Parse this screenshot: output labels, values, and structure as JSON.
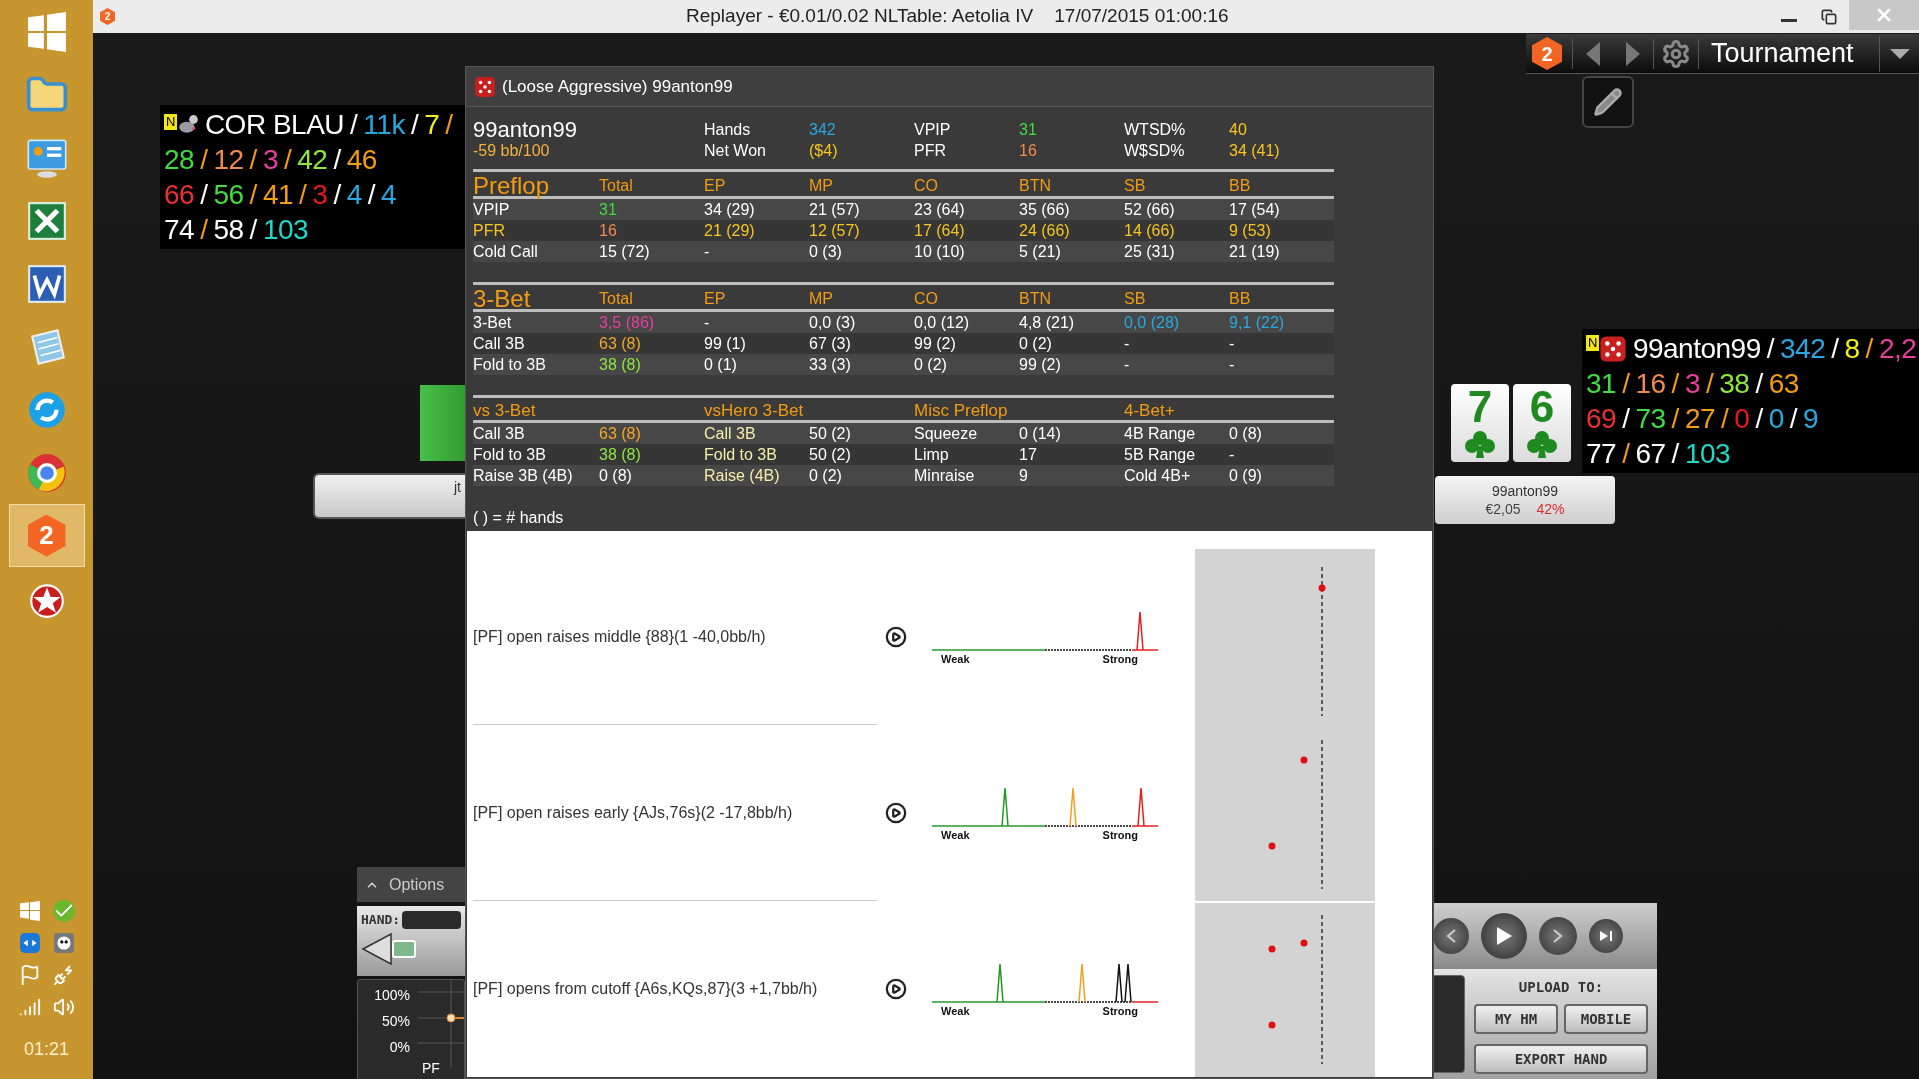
{
  "window": {
    "app_badge": "2",
    "title": "Replayer - €0.01/0.02 NLTable: Aetolia IV    17/07/2015 01:00:16"
  },
  "taskbar": {
    "apps": [
      {
        "kind": "start",
        "selected": false
      },
      {
        "kind": "folder",
        "selected": false
      },
      {
        "kind": "control",
        "selected": false
      },
      {
        "kind": "spreadsheet",
        "selected": false
      },
      {
        "kind": "document",
        "selected": false
      },
      {
        "kind": "notepad",
        "selected": false
      },
      {
        "kind": "chat",
        "selected": false
      },
      {
        "kind": "browser",
        "selected": false
      },
      {
        "kind": "hm",
        "label": "2",
        "selected": true
      },
      {
        "kind": "poker",
        "selected": false
      }
    ],
    "clock": "01:21"
  },
  "toolbar": {
    "badge": "2",
    "profile": "Tournament"
  },
  "hud_left": {
    "note": "N",
    "name": {
      "text": "COR BLAU",
      "color": "#ffffff"
    },
    "header": [
      {
        "text": "/",
        "color": "#ffffff"
      },
      {
        "text": "11k",
        "color": "#29a8e0"
      },
      {
        "text": "/",
        "color": "#ffffff"
      },
      {
        "text": "7",
        "color": "#f0f020"
      },
      {
        "text": "/",
        "color": "#f39c12"
      }
    ],
    "lines": [
      {
        "segments": [
          {
            "text": "28",
            "color": "#3fdc3f"
          },
          {
            "text": "/",
            "color": "#f39c12"
          },
          {
            "text": "12",
            "color": "#f08a4b"
          },
          {
            "text": "/",
            "color": "#f39c12"
          },
          {
            "text": "3",
            "color": "#e83e9c"
          },
          {
            "text": "/",
            "color": "#f39c12"
          },
          {
            "text": "42",
            "color": "#8fe63f"
          },
          {
            "text": "/",
            "color": "#ffffff"
          },
          {
            "text": "46",
            "color": "#f39c12"
          }
        ]
      },
      {
        "segments": [
          {
            "text": "66",
            "color": "#e83030"
          },
          {
            "text": "/",
            "color": "#ffffff"
          },
          {
            "text": "56",
            "color": "#3fdc3f"
          },
          {
            "text": "/",
            "color": "#f39c12"
          },
          {
            "text": "41",
            "color": "#f39c12"
          },
          {
            "text": "/",
            "color": "#f39c12"
          },
          {
            "text": "3",
            "color": "#e81a1a"
          },
          {
            "text": "/",
            "color": "#ffffff"
          },
          {
            "text": "4",
            "color": "#29a8e0"
          },
          {
            "text": "/",
            "color": "#ffffff"
          },
          {
            "text": "4",
            "color": "#29a8e0"
          }
        ]
      },
      {
        "segments": [
          {
            "text": "74",
            "color": "#ffffff"
          },
          {
            "text": "/",
            "color": "#f39c12"
          },
          {
            "text": "58",
            "color": "#ffffff"
          },
          {
            "text": "/",
            "color": "#ffffff"
          },
          {
            "text": "103",
            "color": "#20d8c8"
          }
        ]
      }
    ]
  },
  "left_seat": {
    "name": "jt"
  },
  "hud_right": {
    "note": "N",
    "name": {
      "text": "99anton99",
      "color": "#ffffff"
    },
    "header": [
      {
        "text": "/",
        "color": "#ffffff"
      },
      {
        "text": "342",
        "color": "#29a8e0"
      },
      {
        "text": "/",
        "color": "#ffffff"
      },
      {
        "text": "8",
        "color": "#f0f020"
      },
      {
        "text": "/",
        "color": "#f39c12"
      },
      {
        "text": "2,2",
        "color": "#e83e9c"
      }
    ],
    "lines": [
      {
        "segments": [
          {
            "text": "31",
            "color": "#3fdc3f"
          },
          {
            "text": "/",
            "color": "#f39c12"
          },
          {
            "text": "16",
            "color": "#f08a4b"
          },
          {
            "text": "/",
            "color": "#f39c12"
          },
          {
            "text": "3",
            "color": "#e83e9c"
          },
          {
            "text": "/",
            "color": "#f39c12"
          },
          {
            "text": "38",
            "color": "#8fe63f"
          },
          {
            "text": "/",
            "color": "#ffffff"
          },
          {
            "text": "63",
            "color": "#f39c12"
          }
        ]
      },
      {
        "segments": [
          {
            "text": "69",
            "color": "#e83030"
          },
          {
            "text": "/",
            "color": "#ffffff"
          },
          {
            "text": "73",
            "color": "#3fdc3f"
          },
          {
            "text": "/",
            "color": "#f39c12"
          },
          {
            "text": "27",
            "color": "#f39c12"
          },
          {
            "text": "/",
            "color": "#f39c12"
          },
          {
            "text": "0",
            "color": "#e81a1a"
          },
          {
            "text": "/",
            "color": "#ffffff"
          },
          {
            "text": "0",
            "color": "#29a8e0"
          },
          {
            "text": "/",
            "color": "#ffffff"
          },
          {
            "text": "9",
            "color": "#29a8e0"
          }
        ]
      },
      {
        "segments": [
          {
            "text": "77",
            "color": "#ffffff"
          },
          {
            "text": "/",
            "color": "#f39c12"
          },
          {
            "text": "67",
            "color": "#ffffff"
          },
          {
            "text": "/",
            "color": "#ffffff"
          },
          {
            "text": "103",
            "color": "#20d8c8"
          }
        ]
      }
    ]
  },
  "seat": {
    "cards": [
      {
        "rank": "7"
      },
      {
        "rank": "6"
      }
    ],
    "name": "99anton99",
    "stack": "€2,05",
    "equity": "42%"
  },
  "popup": {
    "title": "(Loose Aggressive) 99anton99",
    "summary": {
      "name": "99anton99",
      "winrate": "-59 bb/100",
      "rows": [
        [
          {
            "text": "Hands",
            "color": "#ffffff"
          },
          {
            "text": "342",
            "color": "#29a8e0"
          },
          {
            "text": "VPIP",
            "color": "#ffffff"
          },
          {
            "text": "31",
            "color": "#3fdc3f"
          },
          {
            "text": "WTSD%",
            "color": "#ffffff"
          },
          {
            "text": "40",
            "color": "#f7c51e"
          }
        ],
        [
          {
            "text": "Net Won",
            "color": "#ffffff"
          },
          {
            "text": "($4)",
            "color": "#f7c51e"
          },
          {
            "text": "PFR",
            "color": "#ffffff"
          },
          {
            "text": "16",
            "color": "#f08a4b"
          },
          {
            "text": "W$SD%",
            "color": "#ffffff"
          },
          {
            "text": "34 (41)",
            "color": "#f7c51e"
          }
        ]
      ]
    },
    "sections": [
      {
        "kind": "major",
        "columns": [
          {
            "text": "Preflop"
          },
          {
            "text": "Total"
          },
          {
            "text": "EP"
          },
          {
            "text": "MP"
          },
          {
            "text": "CO"
          },
          {
            "text": "BTN"
          },
          {
            "text": "SB"
          },
          {
            "text": "BB"
          }
        ],
        "rows": [
          [
            {
              "text": "VPIP",
              "color": "#ffffff"
            },
            {
              "text": "31",
              "color": "#3fdc3f"
            },
            {
              "text": "34 (29)",
              "color": "#ffffff"
            },
            {
              "text": "21 (57)",
              "color": "#ffffff"
            },
            {
              "text": "23 (64)",
              "color": "#ffffff"
            },
            {
              "text": "35 (66)",
              "color": "#ffffff"
            },
            {
              "text": "52 (66)",
              "color": "#ffffff"
            },
            {
              "text": "17 (54)",
              "color": "#ffffff"
            }
          ],
          [
            {
              "text": "PFR",
              "color": "#f7c51e"
            },
            {
              "text": "16",
              "color": "#f08a4b"
            },
            {
              "text": "21 (29)",
              "color": "#f7c51e"
            },
            {
              "text": "12 (57)",
              "color": "#f7c51e"
            },
            {
              "text": "17 (64)",
              "color": "#f7c51e"
            },
            {
              "text": "24 (66)",
              "color": "#f7c51e"
            },
            {
              "text": "14 (66)",
              "color": "#f7c51e"
            },
            {
              "text": "9 (53)",
              "color": "#f7c51e"
            }
          ],
          [
            {
              "text": "Cold Call",
              "color": "#ffffff"
            },
            {
              "text": "15 (72)",
              "color": "#ffffff"
            },
            {
              "text": "-",
              "color": "#ffffff"
            },
            {
              "text": "0 (3)",
              "color": "#ffffff"
            },
            {
              "text": "10 (10)",
              "color": "#ffffff"
            },
            {
              "text": "5 (21)",
              "color": "#ffffff"
            },
            {
              "text": "25 (31)",
              "color": "#ffffff"
            },
            {
              "text": "21 (19)",
              "color": "#ffffff"
            }
          ]
        ]
      },
      {
        "kind": "major",
        "columns": [
          {
            "text": "3-Bet"
          },
          {
            "text": "Total"
          },
          {
            "text": "EP"
          },
          {
            "text": "MP"
          },
          {
            "text": "CO"
          },
          {
            "text": "BTN"
          },
          {
            "text": "SB"
          },
          {
            "text": "BB"
          }
        ],
        "rows": [
          [
            {
              "text": "3-Bet",
              "color": "#ffffff"
            },
            {
              "text": "3,5 (86)",
              "color": "#e83e9c"
            },
            {
              "text": "-",
              "color": "#ffffff"
            },
            {
              "text": "0,0 (3)",
              "color": "#ffffff"
            },
            {
              "text": "0,0 (12)",
              "color": "#ffffff"
            },
            {
              "text": "4,8 (21)",
              "color": "#ffffff"
            },
            {
              "text": "0,0 (28)",
              "color": "#29a8e0"
            },
            {
              "text": "9,1 (22)",
              "color": "#29a8e0"
            }
          ],
          [
            {
              "text": "Call 3B",
              "color": "#ffffff"
            },
            {
              "text": "63 (8)",
              "color": "#f5a623"
            },
            {
              "text": "99 (1)",
              "color": "#ffffff"
            },
            {
              "text": "67 (3)",
              "color": "#ffffff"
            },
            {
              "text": "99 (2)",
              "color": "#ffffff"
            },
            {
              "text": "0 (2)",
              "color": "#ffffff"
            },
            {
              "text": "-",
              "color": "#ffffff"
            },
            {
              "text": "-",
              "color": "#ffffff"
            }
          ],
          [
            {
              "text": "Fold to 3B",
              "color": "#ffffff"
            },
            {
              "text": "38 (8)",
              "color": "#8fe63f"
            },
            {
              "text": "0 (1)",
              "color": "#ffffff"
            },
            {
              "text": "33 (3)",
              "color": "#ffffff"
            },
            {
              "text": "0 (2)",
              "color": "#ffffff"
            },
            {
              "text": "99 (2)",
              "color": "#ffffff"
            },
            {
              "text": "-",
              "color": "#ffffff"
            },
            {
              "text": "-",
              "color": "#ffffff"
            }
          ]
        ]
      },
      {
        "kind": "minor",
        "columns": [
          {
            "text": "vs 3-Bet"
          },
          {
            "text": ""
          },
          {
            "text": "vsHero 3-Bet"
          },
          {
            "text": ""
          },
          {
            "text": "Misc Preflop"
          },
          {
            "text": ""
          },
          {
            "text": "4-Bet+"
          },
          {
            "text": ""
          }
        ],
        "rows": [
          [
            {
              "text": "Call 3B",
              "color": "#ffffff"
            },
            {
              "text": "63 (8)",
              "color": "#f5a623"
            },
            {
              "text": "Call 3B",
              "color": "#f3eeaa"
            },
            {
              "text": "50 (2)",
              "color": "#ffffff"
            },
            {
              "text": "Squeeze",
              "color": "#ffffff"
            },
            {
              "text": "0 (14)",
              "color": "#ffffff"
            },
            {
              "text": "4B Range",
              "color": "#ffffff"
            },
            {
              "text": "0 (8)",
              "color": "#ffffff"
            }
          ],
          [
            {
              "text": "Fold to 3B",
              "color": "#ffffff"
            },
            {
              "text": "38 (8)",
              "color": "#8fe63f"
            },
            {
              "text": "Fold to 3B",
              "color": "#f3eeaa"
            },
            {
              "text": "50 (2)",
              "color": "#ffffff"
            },
            {
              "text": "Limp",
              "color": "#ffffff"
            },
            {
              "text": "17",
              "color": "#ffffff"
            },
            {
              "text": "5B Range",
              "color": "#ffffff"
            },
            {
              "text": "-",
              "color": "#ffffff"
            }
          ],
          [
            {
              "text": "Raise 3B (4B)",
              "color": "#ffffff"
            },
            {
              "text": "0 (8)",
              "color": "#ffffff"
            },
            {
              "text": "Raise (4B)",
              "color": "#f3eeaa"
            },
            {
              "text": "0 (2)",
              "color": "#ffffff"
            },
            {
              "text": "Minraise",
              "color": "#ffffff"
            },
            {
              "text": "9",
              "color": "#ffffff"
            },
            {
              "text": "Cold 4B+",
              "color": "#ffffff"
            },
            {
              "text": "0 (9)",
              "color": "#ffffff"
            }
          ]
        ]
      }
    ],
    "footnote": "( ) = # hands",
    "hands": [
      {
        "description": "[PF] open raises middle {88}(1 -40,0bb/h)",
        "weak": "Weak",
        "strong": "Strong"
      },
      {
        "description": "[PF] open raises early {AJs,76s}(2 -17,8bb/h)",
        "weak": "Weak",
        "strong": "Strong"
      },
      {
        "description": "[PF] opens from cutoff {A6s,KQs,87}(3 +1,7bb/h)",
        "weak": "Weak",
        "strong": "Strong"
      }
    ]
  },
  "options": {
    "label": "Options",
    "hand_label": "HAND:",
    "axis": [
      "100%",
      "50%",
      "0%"
    ],
    "street": "PF"
  },
  "controls": {
    "upload_label": "UPLOAD TO:",
    "upload_buttons": [
      "MY HM",
      "MOBILE"
    ],
    "export": "EXPORT HAND"
  }
}
